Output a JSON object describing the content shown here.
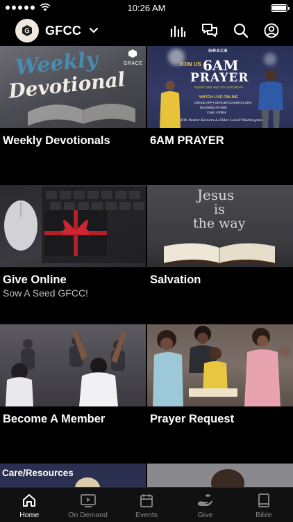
{
  "status": {
    "time": "10:26 AM"
  },
  "header": {
    "brand_name": "GFCC"
  },
  "tiles": [
    {
      "title": "Weekly Devotionals",
      "subtitle": "",
      "thumb_text_1": "Weekly",
      "thumb_text_2": "Devotional",
      "badge": "GRACE"
    },
    {
      "title": "6AM PRAYER",
      "subtitle": "",
      "badge": "GRACE",
      "join": "JOIN US",
      "big": "6AM",
      "big2": "PRAYER",
      "schedule": "EVERY 2ND AND 4TH SATURDAY",
      "watch": "WATCH LIVE ONLINE",
      "watch2": "GRACE APP | GRACEFCCHURCH.ORG",
      "dial": "Dial (605)475-4300",
      "code": "Code: 410654",
      "hosts": "With Pastor Keinem & Elder Lovell Washington"
    },
    {
      "title": "Give Online",
      "subtitle": "Sow A Seed GFCC!"
    },
    {
      "title": "Salvation",
      "subtitle": "",
      "board_1": "Jesus",
      "board_2": "is",
      "board_3": "the way"
    },
    {
      "title": "Become A Member",
      "subtitle": ""
    },
    {
      "title": "Prayer Request",
      "subtitle": ""
    }
  ],
  "care": {
    "label": "Care/Resources"
  },
  "tabs": [
    {
      "label": "Home",
      "icon": "home-icon",
      "active": true
    },
    {
      "label": "On Demand",
      "icon": "play-icon",
      "active": false
    },
    {
      "label": "Events",
      "icon": "calendar-icon",
      "active": false
    },
    {
      "label": "Give",
      "icon": "give-hand-icon",
      "active": false
    },
    {
      "label": "Bible",
      "icon": "book-icon",
      "active": false
    }
  ],
  "colors": {
    "background": "#000000",
    "tab_bar": "#111111",
    "prayer_blue": "#2f3660",
    "prayer_gold": "#e7c84a"
  }
}
